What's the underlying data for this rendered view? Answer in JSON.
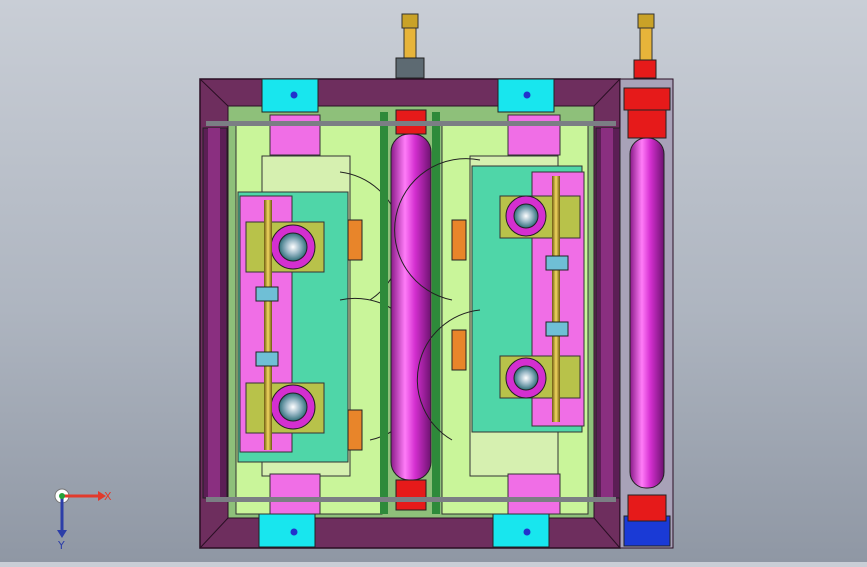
{
  "viewport": {
    "background_top": "#c9ced6",
    "background_bottom": "#8f97a4"
  },
  "triad": {
    "x_label": "X",
    "y_label": "Y",
    "x_color": "#e23a2c",
    "y_color": "#2c3ea8",
    "origin_color": "#25a23a"
  },
  "colors": {
    "frame": "#6e2e5e",
    "frame_dark": "#4a1c40",
    "cyan": "#18e6ee",
    "pink": "#f06ee6",
    "magenta_roll": "#d42fd0",
    "red": "#e61a1a",
    "lime": "#c9f59a",
    "green_plate": "#4fd6a8",
    "olive": "#b8c24a",
    "yellow_green": "#c8e05a",
    "blue_block": "#1a3ad6",
    "orange": "#e8852a",
    "gold": "#c9a227"
  }
}
